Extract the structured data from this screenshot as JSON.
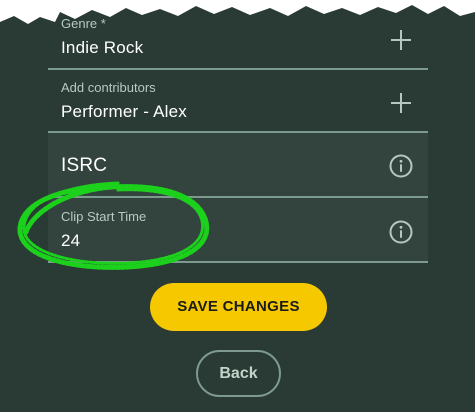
{
  "genre": {
    "label": "Genre *",
    "value": "Indie Rock"
  },
  "contributors": {
    "label": "Add contributors",
    "value": "Performer - Alex"
  },
  "isrc": {
    "placeholder": "ISRC"
  },
  "clip_start": {
    "label": "Clip Start Time",
    "value": "24"
  },
  "actions": {
    "save_label": "SAVE CHANGES",
    "back_label": "Back"
  },
  "icons": {
    "add": "plus-icon",
    "info": "info-circle-icon"
  },
  "colors": {
    "background": "#2a3a34",
    "accent": "#f5c800",
    "highlight_annotation": "#1cd11c"
  }
}
